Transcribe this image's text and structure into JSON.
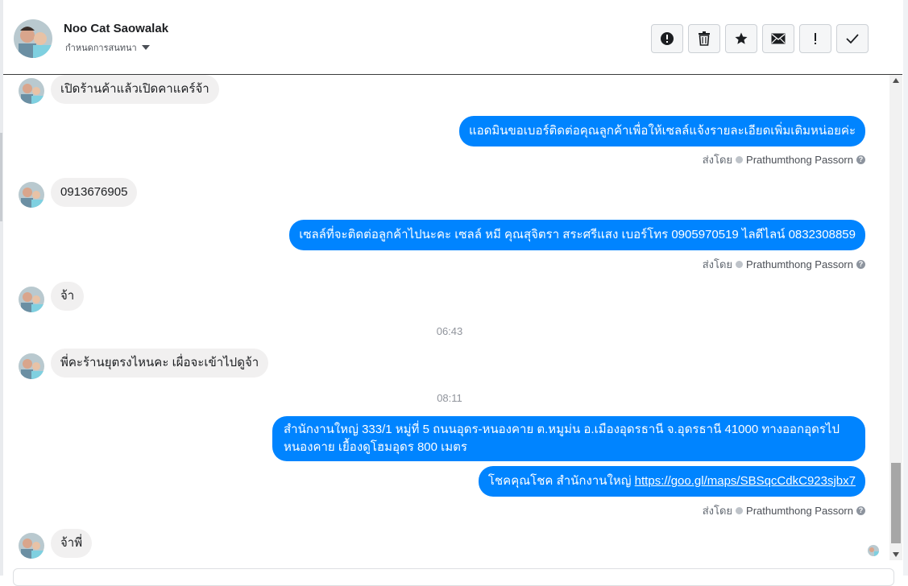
{
  "header": {
    "contact_name": "Noo Cat Saowalak",
    "assign_label": "กำหนดการสนทนา"
  },
  "toolbar": {
    "buttons": [
      {
        "icon": "exclamation-circle-icon",
        "action": "mark as spam"
      },
      {
        "icon": "trash-icon",
        "action": "delete"
      },
      {
        "icon": "star-icon",
        "action": "star"
      },
      {
        "icon": "envelope-icon",
        "action": "mark as unread"
      },
      {
        "icon": "exclamation-icon",
        "action": "follow up"
      },
      {
        "icon": "check-icon",
        "action": "mark as done"
      }
    ]
  },
  "messages": {
    "m1": "เปิดร้านค้าแล้วเปิดคาแคร์จ้า",
    "m2": "แอดมินขอเบอร์ติดต่อคุณลูกค้าเพื่อให้เซลล์แจ้งรายละเอียดเพิ่มเติมหน่อยค่ะ",
    "m3": "0913676905",
    "m4": "เซลล์ที่จะติดต่อลูกค้าไปนะคะ เซลล์ หมี คุณสุจิตรา สระศรีแสง เบอร์โทร 0905970519 ไลดีไลน์ 0832308859",
    "m5": "จ้า",
    "time1": "06:43",
    "m6": "พี่คะร้านยุตรงไหนคะ เผื่อจะเข้าไปดูจ้า",
    "time2": "08:11",
    "m7": "สำนักงานใหญ่ 333/1 หมู่ที่ 5 ถนนอุดร-หนองคาย ต.หมูม่น อ.เมืองอุดรธานี จ.อุดรธานี 41000 ทางออกอุดรไปหนองคาย เยื้องดูโฮมอุดร 800 เมตร",
    "m8_prefix": "โชคคุณโชค สำนักงานใหญ่ ",
    "m8_link": "https://goo.gl/maps/SBSqcCdkC923sjbx7",
    "m9": "จ้าพี่"
  },
  "sent_by": {
    "label": "ส่งโดย",
    "name": "Prathumthong Passorn"
  },
  "colors": {
    "outgoing_bubble": "#0084ff",
    "incoming_bubble": "#f1f0f0"
  }
}
